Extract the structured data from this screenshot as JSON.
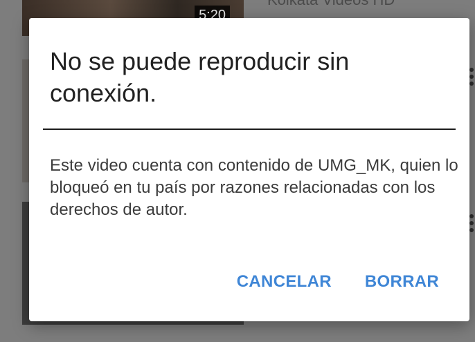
{
  "background": {
    "video_title_partial": "Kolkata Videos HD",
    "video_duration": "5:20"
  },
  "dialog": {
    "title": "No se puede reproducir sin conexión.",
    "message": "Este video cuenta con contenido de UMG_MK, quien lo bloqueó en tu país por razones relacionadas con los derechos de autor.",
    "cancel_label": "CANCELAR",
    "delete_label": "BORRAR"
  },
  "colors": {
    "accent": "#3f86d6",
    "scrim": "#7d7d7d",
    "dialog_bg": "#ffffff"
  }
}
